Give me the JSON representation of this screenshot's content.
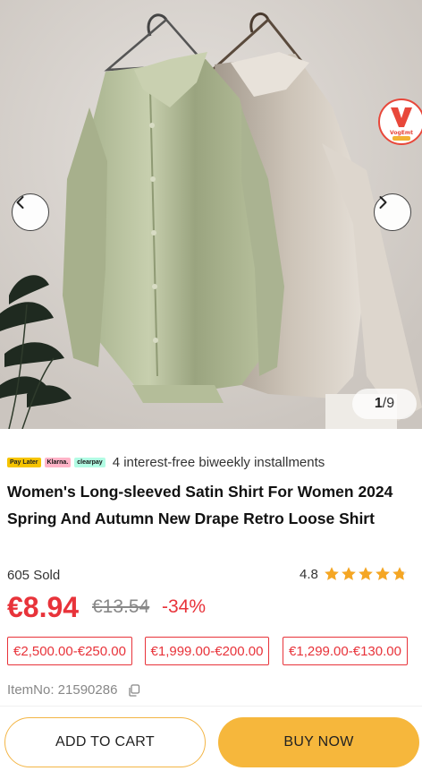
{
  "gallery": {
    "current": "1",
    "total": "/9",
    "badge_text": "VogEmt"
  },
  "payment": {
    "logos": [
      "Pay Later",
      "Klarna.",
      "clearpay"
    ],
    "text": "4 interest-free biweekly installments"
  },
  "product": {
    "title": "Women's Long-sleeved Satin Shirt For Women 2024 Spring And Autumn New Drape Retro Loose Shirt",
    "sold": "605 Sold",
    "rating": "4.8",
    "rating_value": 4.8,
    "stars_max": 5,
    "price": "€8.94",
    "original_price": "€13.54",
    "discount": "-34%",
    "item_no": "ItemNo: 21590286"
  },
  "coupons": [
    "€2,500.00-€250.00",
    "€1,999.00-€200.00",
    "€1,299.00-€130.00"
  ],
  "actions": {
    "add_to_cart": "ADD TO CART",
    "buy_now": "BUY NOW"
  },
  "colors": {
    "price_red": "#e8333a",
    "buy_orange": "#f6b73c",
    "star_orange": "#f5a623"
  },
  "icons": [
    "chevron-left-icon",
    "chevron-right-icon",
    "copy-icon",
    "star-icon"
  ]
}
